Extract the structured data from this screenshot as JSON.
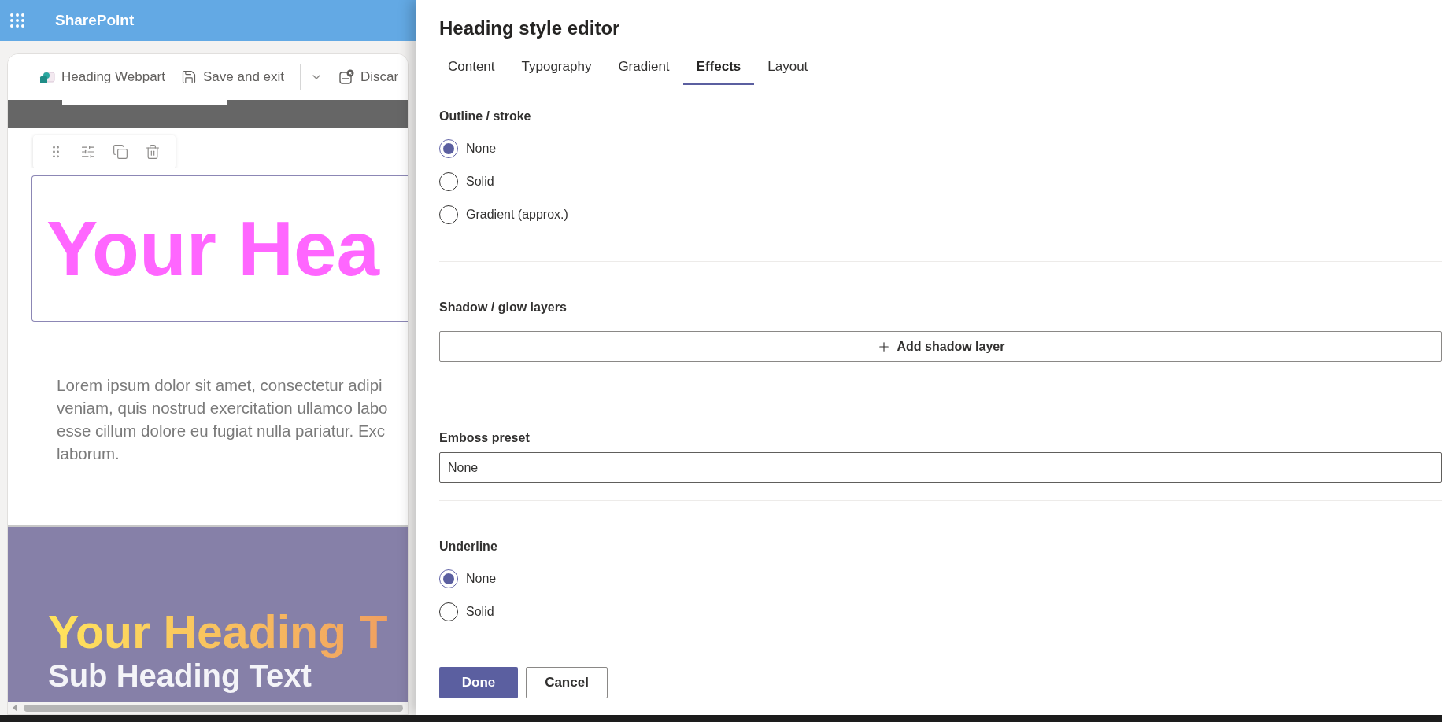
{
  "app_bar": {
    "title": "SharePoint"
  },
  "edit_toolbar": {
    "items": [
      {
        "kind": "webpart",
        "label": "Heading Webpart"
      },
      {
        "kind": "save",
        "label": "Save and exit"
      },
      {
        "kind": "dropdown"
      },
      {
        "kind": "discard",
        "label": "Discar"
      }
    ]
  },
  "canvas": {
    "heading": "Your Hea",
    "paragraph_lines": [
      "Lorem ipsum dolor sit amet, consectetur adipi",
      "veniam, quis nostrud exercitation ullamco labo",
      "esse cillum dolore eu fugiat nulla pariatur. Exc",
      "laborum."
    ],
    "banner": {
      "heading": "Your Heading T",
      "subheading": "Sub Heading Text"
    }
  },
  "panel": {
    "title": "Heading style editor",
    "tabs": [
      {
        "label": "Content",
        "selected": false
      },
      {
        "label": "Typography",
        "selected": false
      },
      {
        "label": "Gradient",
        "selected": false
      },
      {
        "label": "Effects",
        "selected": true
      },
      {
        "label": "Layout",
        "selected": false
      }
    ],
    "sections": [
      {
        "kind": "radio",
        "heading": "Outline / stroke",
        "options": [
          {
            "label": "None",
            "selected": true
          },
          {
            "label": "Solid",
            "selected": false
          },
          {
            "label": "Gradient (approx.)",
            "selected": false
          }
        ]
      },
      {
        "kind": "button",
        "heading": "Shadow / glow layers",
        "button": "Add shadow layer"
      },
      {
        "kind": "select",
        "heading": "Emboss preset",
        "value": "None"
      },
      {
        "kind": "radio",
        "heading": "Underline",
        "options": [
          {
            "label": "None",
            "selected": true
          },
          {
            "label": "Solid",
            "selected": false
          }
        ]
      }
    ],
    "buttons": [
      {
        "kind": "primary",
        "label": "Done"
      },
      {
        "kind": "secondary",
        "label": "Cancel"
      }
    ]
  }
}
